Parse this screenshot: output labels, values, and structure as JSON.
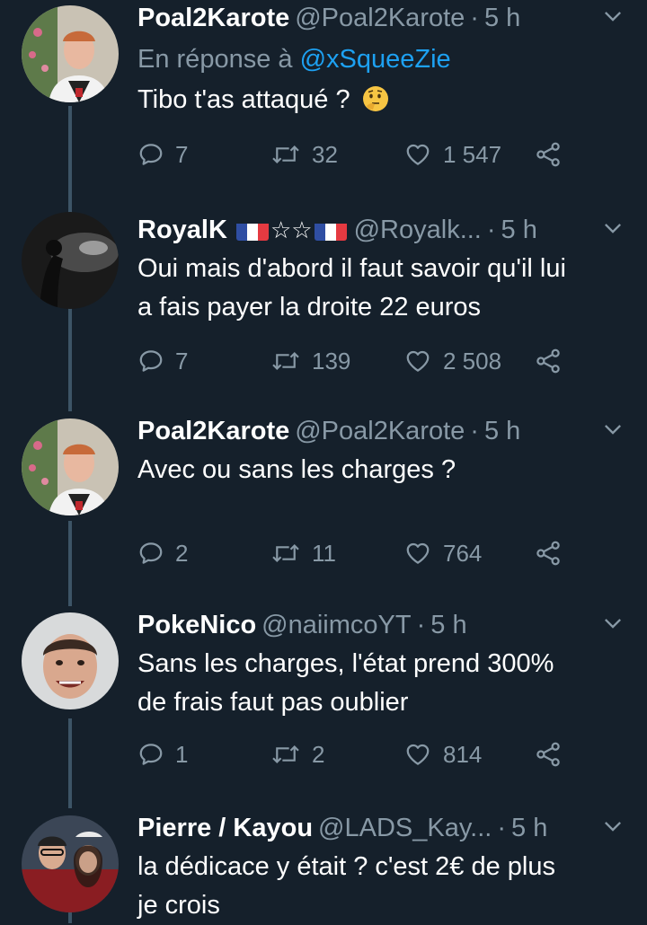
{
  "tweets": [
    {
      "name": "Poal2Karote",
      "handle": "@Poal2Karote",
      "time": "5 h",
      "reply_prefix": "En réponse à",
      "reply_mention": "@xSqueeZie",
      "text": "Tibo t'as attaqué ?",
      "emoji": "thinking-face",
      "replies": "7",
      "retweets": "32",
      "likes": "1 547"
    },
    {
      "name": "RoyalK",
      "name_decoration": "☆☆",
      "handle": "@Royalk...",
      "time": "5 h",
      "text_line1": "Oui mais d'abord il faut savoir qu'il lui",
      "text_line2": "a fais payer la droite 22 euros",
      "replies": "7",
      "retweets": "139",
      "likes": "2 508"
    },
    {
      "name": "Poal2Karote",
      "handle": "@Poal2Karote",
      "time": "5 h",
      "text": "Avec ou sans les charges ?",
      "replies": "2",
      "retweets": "11",
      "likes": "764"
    },
    {
      "name": "PokeNico",
      "handle": "@naiimcoYT",
      "time": "5 h",
      "text_line1": "Sans les charges, l'état prend 300%",
      "text_line2": "de frais faut pas oublier",
      "replies": "1",
      "retweets": "2",
      "likes": "814"
    },
    {
      "name": "Pierre / Kayou",
      "handle": "@LADS_Kay...",
      "time": "5 h",
      "text_line1": "la dédicace y était ? c'est 2€ de plus",
      "text_line2": "je crois"
    }
  ],
  "colors": {
    "background": "#15202b",
    "secondary_text": "#8899a6",
    "link": "#1da1f2",
    "thread_line": "#3d5466"
  }
}
